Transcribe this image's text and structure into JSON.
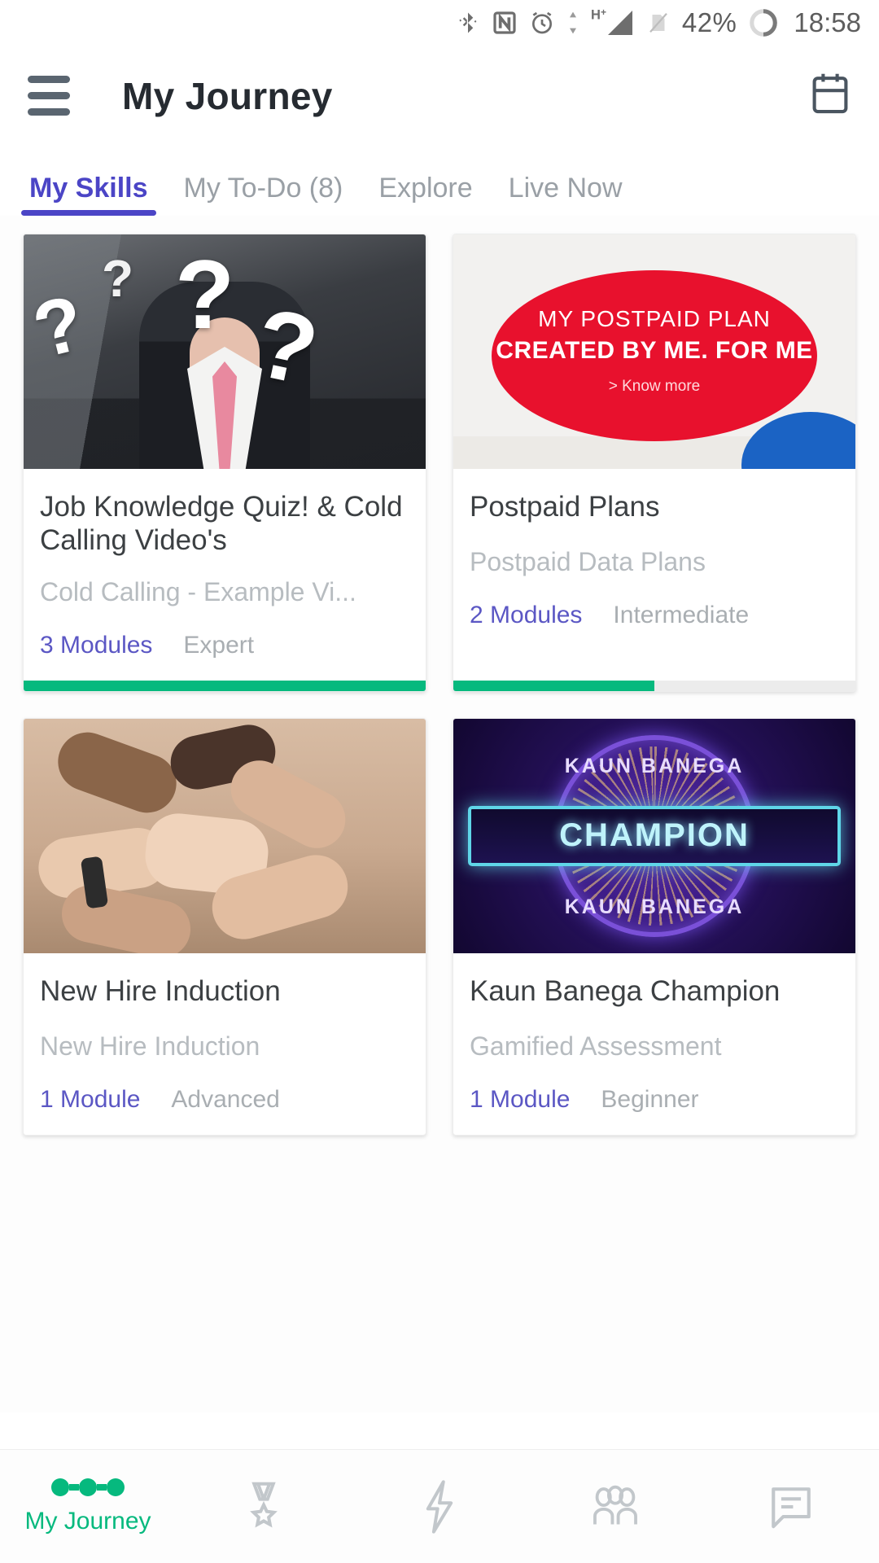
{
  "status_bar": {
    "icons": [
      "bluetooth-icon",
      "nfc-icon",
      "alarm-icon",
      "data-transfer-icon",
      "hplus-signal-icon",
      "sim-off-icon"
    ],
    "network_type": "H+",
    "battery_percent": "42%",
    "time": "18:58"
  },
  "app_bar": {
    "menu_icon": "hamburger-menu-icon",
    "title": "My Journey",
    "calendar_icon": "calendar-icon"
  },
  "tabs": [
    {
      "label": "My Skills",
      "active": true
    },
    {
      "label": "My To-Do (8)",
      "active": false
    },
    {
      "label": "Explore",
      "active": false
    },
    {
      "label": "Live Now",
      "active": false
    }
  ],
  "colors": {
    "accent_purple": "#4b45c6",
    "progress_green": "#06b97e",
    "muted_text": "#a9aeb2",
    "title_text": "#3c4043"
  },
  "cards": [
    {
      "title": "Job Knowledge Quiz!  & Cold Calling Video's",
      "subtitle": "Cold Calling - Example Vi...",
      "modules": "3 Modules",
      "level": "Expert",
      "progress_percent": 100,
      "thumbnail": "businessman-question-marks-image"
    },
    {
      "title": "Postpaid Plans",
      "subtitle": "Postpaid Data Plans",
      "modules": "2 Modules",
      "level": "Intermediate",
      "progress_percent": 50,
      "thumbnail": "postpaid-plan-banner-image",
      "banner_line1": "MY POSTPAID PLAN",
      "banner_line2": "CREATED BY ME. FOR ME",
      "banner_line3": "> Know more"
    },
    {
      "title": "New Hire Induction",
      "subtitle": "New Hire Induction",
      "modules": "1 Module",
      "level": "Advanced",
      "progress_percent": 0,
      "thumbnail": "hands-together-teamwork-image"
    },
    {
      "title": "Kaun Banega Champion",
      "subtitle": "Gamified Assessment",
      "modules": "1 Module",
      "level": "Beginner",
      "progress_percent": 0,
      "thumbnail": "kaun-banega-champion-image",
      "art_top": "KAUN BANEGA",
      "art_center": "CHAMPION",
      "art_bottom": "KAUN BANEGA"
    }
  ],
  "bottom_nav": [
    {
      "label": "My Journey",
      "icon": "journey-dots-icon",
      "active": true
    },
    {
      "label": "",
      "icon": "medal-icon",
      "active": false
    },
    {
      "label": "",
      "icon": "lightning-bolt-icon",
      "active": false
    },
    {
      "label": "",
      "icon": "people-group-icon",
      "active": false
    },
    {
      "label": "",
      "icon": "chat-message-icon",
      "active": false
    }
  ]
}
